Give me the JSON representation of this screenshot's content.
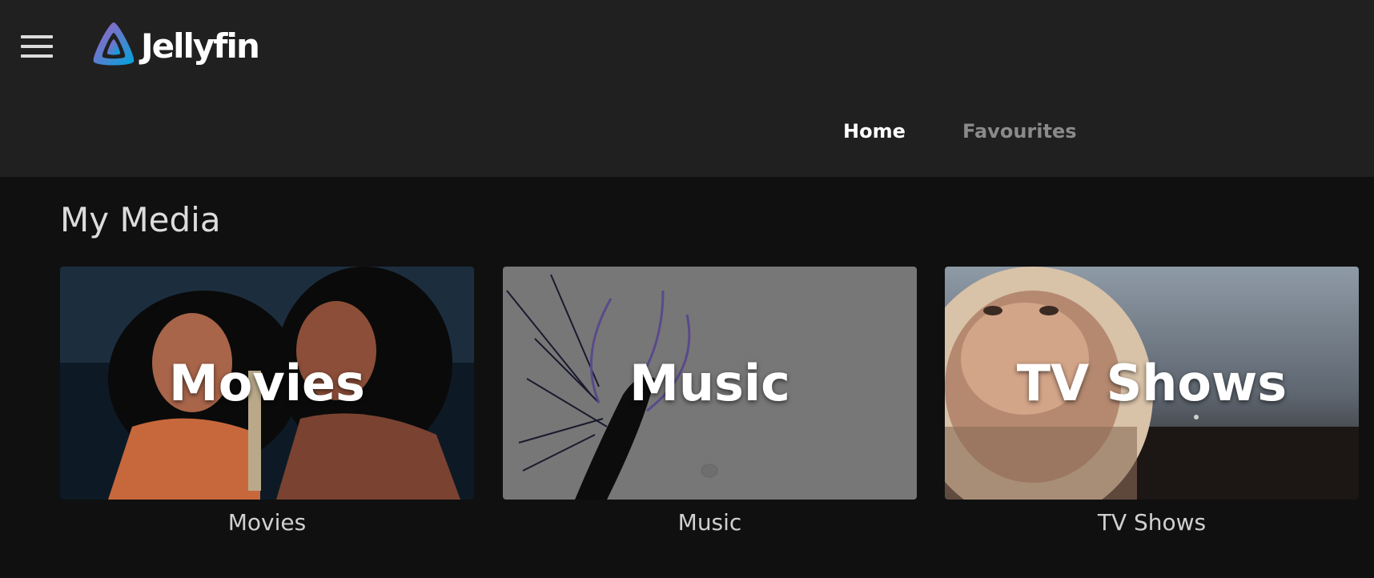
{
  "app": {
    "name": "Jellyfin",
    "accent_colors": [
      "#aa5cc3",
      "#00a4dc"
    ]
  },
  "header": {
    "menu_icon": "hamburger-menu-icon",
    "tabs": [
      {
        "label": "Home",
        "active": true
      },
      {
        "label": "Favourites",
        "active": false
      }
    ]
  },
  "main": {
    "section_title": "My Media",
    "libraries": [
      {
        "title": "Movies",
        "label": "Movies"
      },
      {
        "title": "Music",
        "label": "Music"
      },
      {
        "title": "TV Shows",
        "label": "TV Shows"
      }
    ]
  }
}
